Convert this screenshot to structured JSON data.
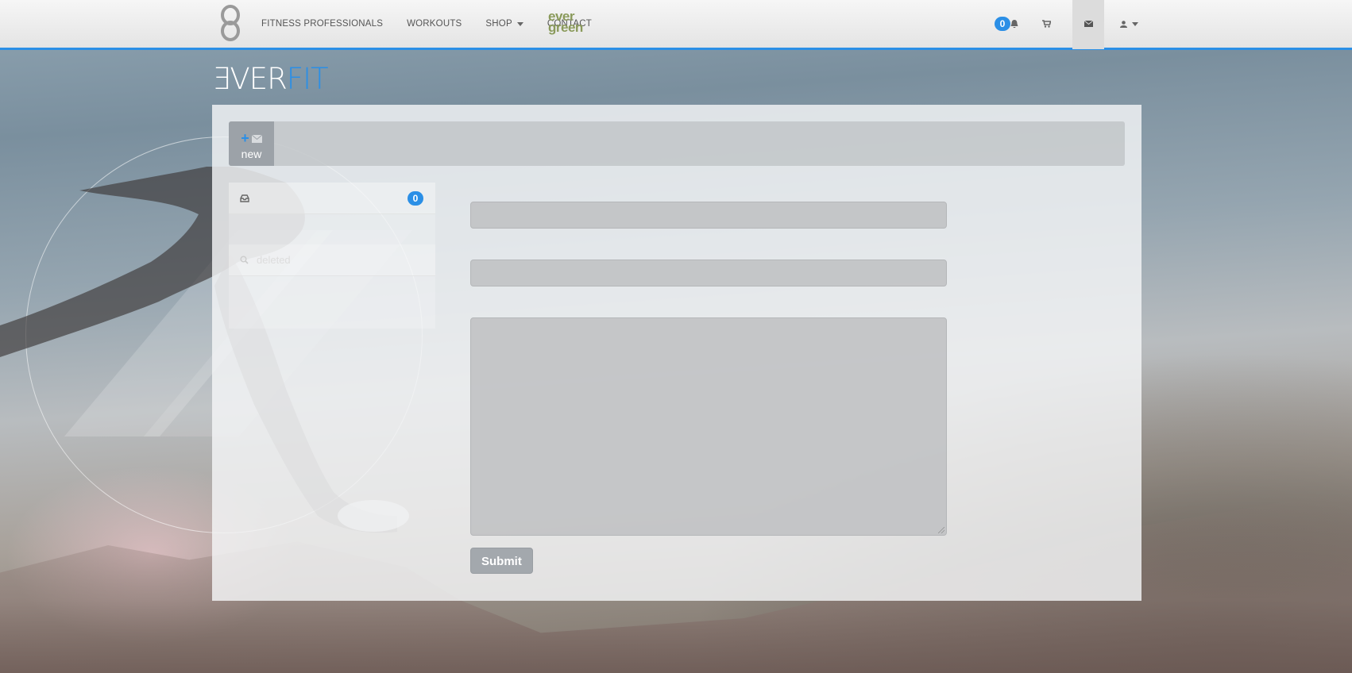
{
  "nav": {
    "links": [
      {
        "label": "FITNESS PROFESSIONALS"
      },
      {
        "label": "WORKOUTS"
      },
      {
        "label": "SHOP"
      },
      {
        "label": "CONTACT"
      }
    ],
    "partner_logo_top": "ever",
    "partner_logo_bottom": "green",
    "notification_count": "0",
    "icons": {
      "notifications": "bell-icon",
      "cart": "cart-icon",
      "messages": "envelope-icon",
      "user": "user-icon"
    },
    "accent_color": "#2b8fe6"
  },
  "brand": {
    "part1": "ƎVER",
    "part2": "FIT"
  },
  "toolbar": {
    "new_label": "new",
    "new_icons": [
      "plus-icon",
      "envelope-icon"
    ]
  },
  "sidebar": {
    "inbox_count": "0",
    "deleted_label": "deleted",
    "icons": {
      "inbox": "inbox-icon",
      "deleted": "search-icon"
    }
  },
  "form": {
    "submit_label": "Submit"
  }
}
